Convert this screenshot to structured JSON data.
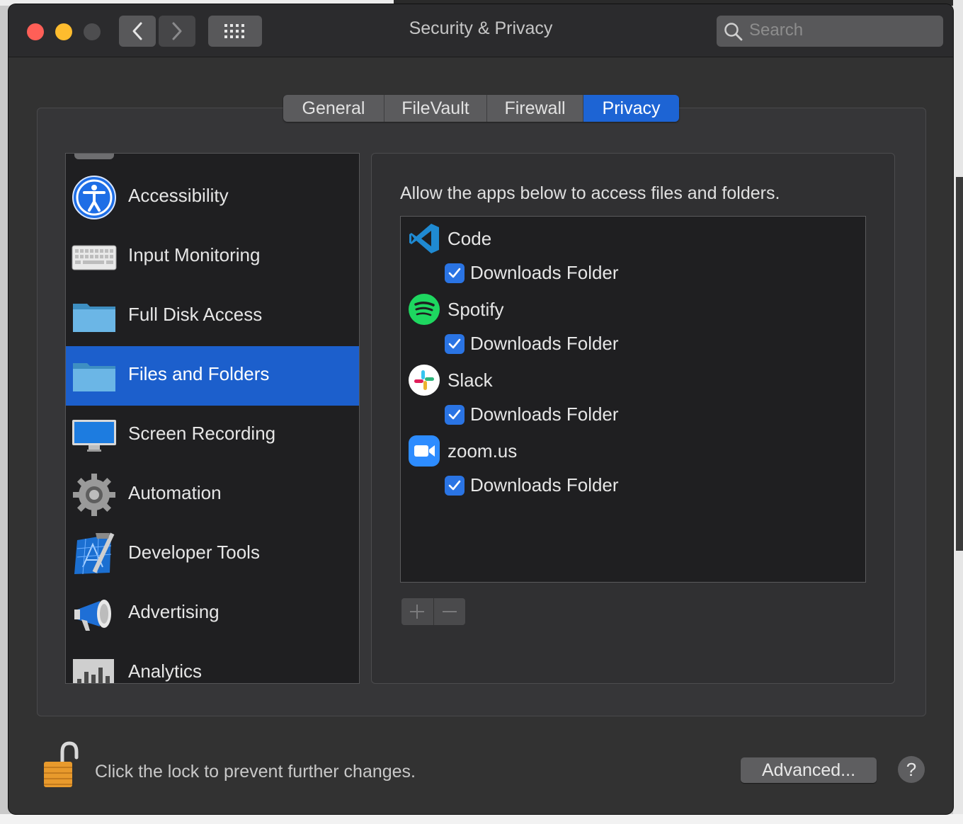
{
  "window": {
    "title": "Security & Privacy",
    "search_placeholder": "Search"
  },
  "tabs": [
    {
      "label": "General",
      "active": false
    },
    {
      "label": "FileVault",
      "active": false
    },
    {
      "label": "Firewall",
      "active": false
    },
    {
      "label": "Privacy",
      "active": true
    }
  ],
  "categories": [
    {
      "label": "Accessibility",
      "icon": "accessibility-icon"
    },
    {
      "label": "Input Monitoring",
      "icon": "keyboard-icon"
    },
    {
      "label": "Full Disk Access",
      "icon": "folder-icon"
    },
    {
      "label": "Files and Folders",
      "icon": "folder-icon",
      "selected": true
    },
    {
      "label": "Screen Recording",
      "icon": "display-icon"
    },
    {
      "label": "Automation",
      "icon": "gear-icon"
    },
    {
      "label": "Developer Tools",
      "icon": "xcode-icon"
    },
    {
      "label": "Advertising",
      "icon": "megaphone-icon"
    },
    {
      "label": "Analytics",
      "icon": "analytics-chart-icon"
    }
  ],
  "detail": {
    "heading": "Allow the apps below to access files and folders.",
    "apps": [
      {
        "name": "Code",
        "icon": "vscode-icon",
        "permissions": [
          {
            "label": "Downloads Folder",
            "checked": true
          }
        ]
      },
      {
        "name": "Spotify",
        "icon": "spotify-icon",
        "permissions": [
          {
            "label": "Downloads Folder",
            "checked": true
          }
        ]
      },
      {
        "name": "Slack",
        "icon": "slack-icon",
        "permissions": [
          {
            "label": "Downloads Folder",
            "checked": true
          }
        ]
      },
      {
        "name": "zoom.us",
        "icon": "zoom-icon",
        "permissions": [
          {
            "label": "Downloads Folder",
            "checked": true
          }
        ]
      }
    ],
    "add_symbol": "+",
    "remove_symbol": "−"
  },
  "footer": {
    "lock_message": "Click the lock to prevent further changes.",
    "advanced_label": "Advanced...",
    "help_label": "?"
  },
  "colors": {
    "accent": "#1d64d4",
    "selection": "#1c5fcc",
    "checkbox": "#2a74e4"
  }
}
